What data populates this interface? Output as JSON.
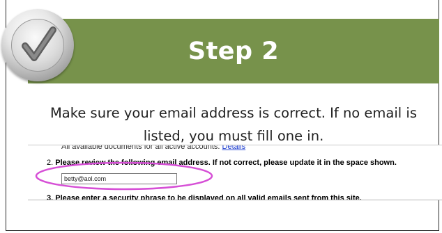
{
  "step": {
    "title": "Step 2",
    "instructions": "Make sure your email address is correct. If no email is listed, you must fill one in.",
    "badge_icon": "checkmark-icon"
  },
  "screenshot": {
    "line_top_text": "All available documents for all active accounts.",
    "line_top_link": "Details",
    "item2_number": "2.",
    "item2_text": "Please review the following email address. If not correct, please update it in the space shown.",
    "email_value": "betty@aol.com",
    "item3_text": "3. Please enter a security phrase to be displayed on all valid emails sent from this site."
  },
  "colors": {
    "banner": "#77924b",
    "highlight": "#d64fd6",
    "link": "#1f3fd0"
  }
}
